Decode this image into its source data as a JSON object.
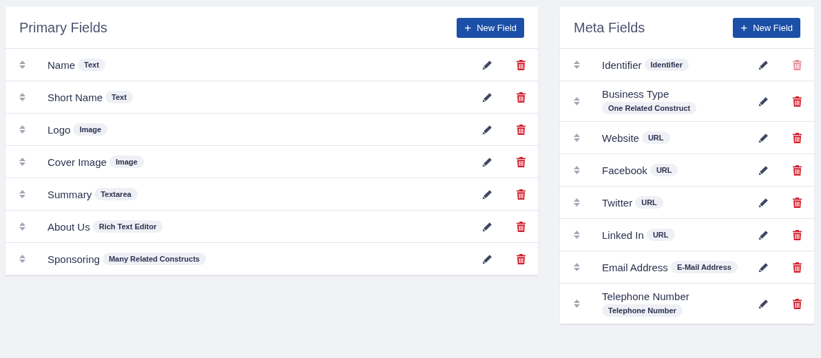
{
  "panels": [
    {
      "title": "Primary Fields",
      "button": {
        "icon": "+",
        "label": "New Field"
      },
      "fields": [
        {
          "name": "Name",
          "type": "Text",
          "delete_disabled": false
        },
        {
          "name": "Short Name",
          "type": "Text",
          "delete_disabled": false
        },
        {
          "name": "Logo",
          "type": "Image",
          "delete_disabled": false
        },
        {
          "name": "Cover Image",
          "type": "Image",
          "delete_disabled": false
        },
        {
          "name": "Summary",
          "type": "Textarea",
          "delete_disabled": false
        },
        {
          "name": "About Us",
          "type": "Rich Text Editor",
          "delete_disabled": false
        },
        {
          "name": "Sponsoring",
          "type": "Many Related Constructs",
          "delete_disabled": false
        }
      ]
    },
    {
      "title": "Meta Fields",
      "button": {
        "icon": "+",
        "label": "New Field"
      },
      "fields": [
        {
          "name": "Identifier",
          "type": "Identifier",
          "delete_disabled": true
        },
        {
          "name": "Business Type",
          "type": "One Related Construct",
          "delete_disabled": false
        },
        {
          "name": "Website",
          "type": "URL",
          "delete_disabled": false
        },
        {
          "name": "Facebook",
          "type": "URL",
          "delete_disabled": false
        },
        {
          "name": "Twitter",
          "type": "URL",
          "delete_disabled": false
        },
        {
          "name": "Linked In",
          "type": "URL",
          "delete_disabled": false
        },
        {
          "name": "Email Address",
          "type": "E-Mail Address",
          "delete_disabled": false
        },
        {
          "name": "Telephone Number",
          "type": "Telephone Number",
          "delete_disabled": false
        }
      ]
    }
  ]
}
